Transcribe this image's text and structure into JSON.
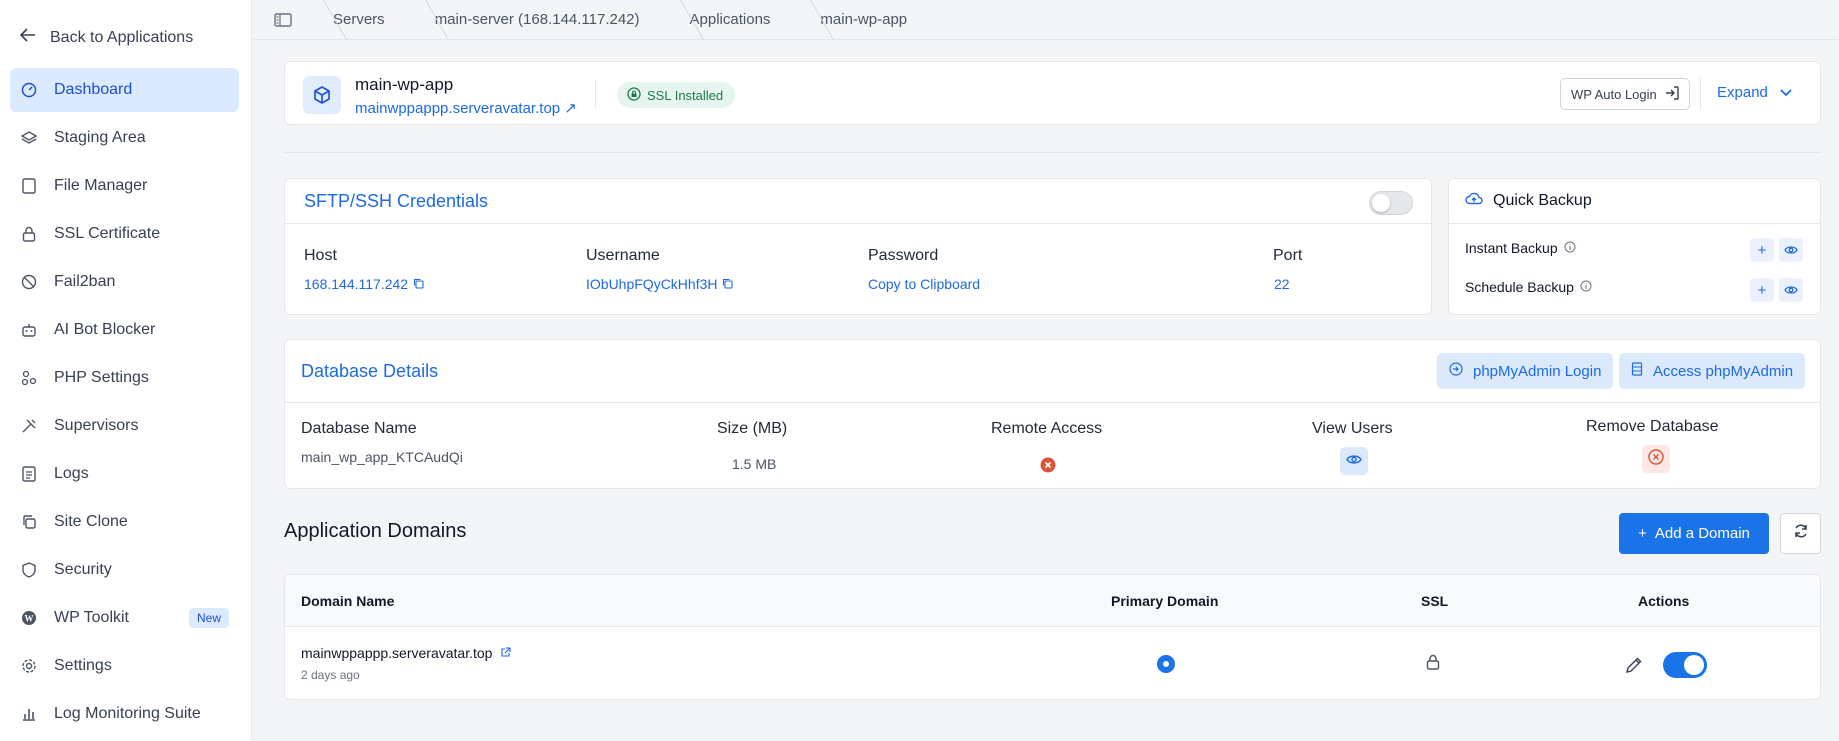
{
  "sidebar": {
    "back_label": "Back to Applications",
    "items": [
      {
        "label": "Dashboard",
        "icon": "gauge-icon"
      },
      {
        "label": "Staging Area",
        "icon": "layers-icon"
      },
      {
        "label": "File Manager",
        "icon": "file-icon"
      },
      {
        "label": "SSL Certificate",
        "icon": "lock-icon"
      },
      {
        "label": "Fail2ban",
        "icon": "ban-icon"
      },
      {
        "label": "AI Bot Blocker",
        "icon": "robot-icon"
      },
      {
        "label": "PHP Settings",
        "icon": "nodes-icon"
      },
      {
        "label": "Supervisors",
        "icon": "tools-icon"
      },
      {
        "label": "Logs",
        "icon": "document-icon"
      },
      {
        "label": "Site Clone",
        "icon": "copy-icon"
      },
      {
        "label": "Security",
        "icon": "shield-icon"
      },
      {
        "label": "WP Toolkit",
        "icon": "wordpress-icon",
        "badge": "New"
      },
      {
        "label": "Settings",
        "icon": "gear-icon"
      },
      {
        "label": "Log Monitoring Suite",
        "icon": "bar-chart-icon"
      }
    ]
  },
  "breadcrumb": [
    "Servers",
    "main-server (168.144.117.242)",
    "Applications",
    "main-wp-app"
  ],
  "app": {
    "name": "main-wp-app",
    "url": "mainwppappp.serveravatar.top",
    "ssl_status": "SSL Installed",
    "wp_login_label": "WP Auto Login",
    "expand_label": "Expand"
  },
  "sftp": {
    "title": "SFTP/SSH Credentials",
    "host_label": "Host",
    "host": "168.144.117.242",
    "username_label": "Username",
    "username": "IObUhpFQyCkHhf3H",
    "password_label": "Password",
    "password": "Copy to Clipboard",
    "port_label": "Port",
    "port": "22"
  },
  "backup": {
    "title": "Quick Backup",
    "instant": "Instant Backup",
    "schedule": "Schedule Backup"
  },
  "database": {
    "title": "Database Details",
    "pma_login": "phpMyAdmin Login",
    "pma_access": "Access phpMyAdmin",
    "name_label": "Database Name",
    "name": "main_wp_app_KTCAudQi",
    "size_label": "Size (MB)",
    "size": "1.5 MB",
    "remote_label": "Remote Access",
    "users_label": "View Users",
    "remove_label": "Remove Database"
  },
  "domains": {
    "title": "Application Domains",
    "add_label": "Add a Domain",
    "headers": [
      "Domain Name",
      "Primary Domain",
      "SSL",
      "Actions"
    ],
    "rows": [
      {
        "domain": "mainwppappp.serveravatar.top",
        "added": "2 days ago",
        "primary": true,
        "enabled": true
      }
    ]
  },
  "colors": {
    "accent": "#1a73e8",
    "link": "#1d6ae5",
    "active_bg": "#dbeafe",
    "ssl_bg": "#e6f6ee",
    "danger": "#d9533c"
  }
}
